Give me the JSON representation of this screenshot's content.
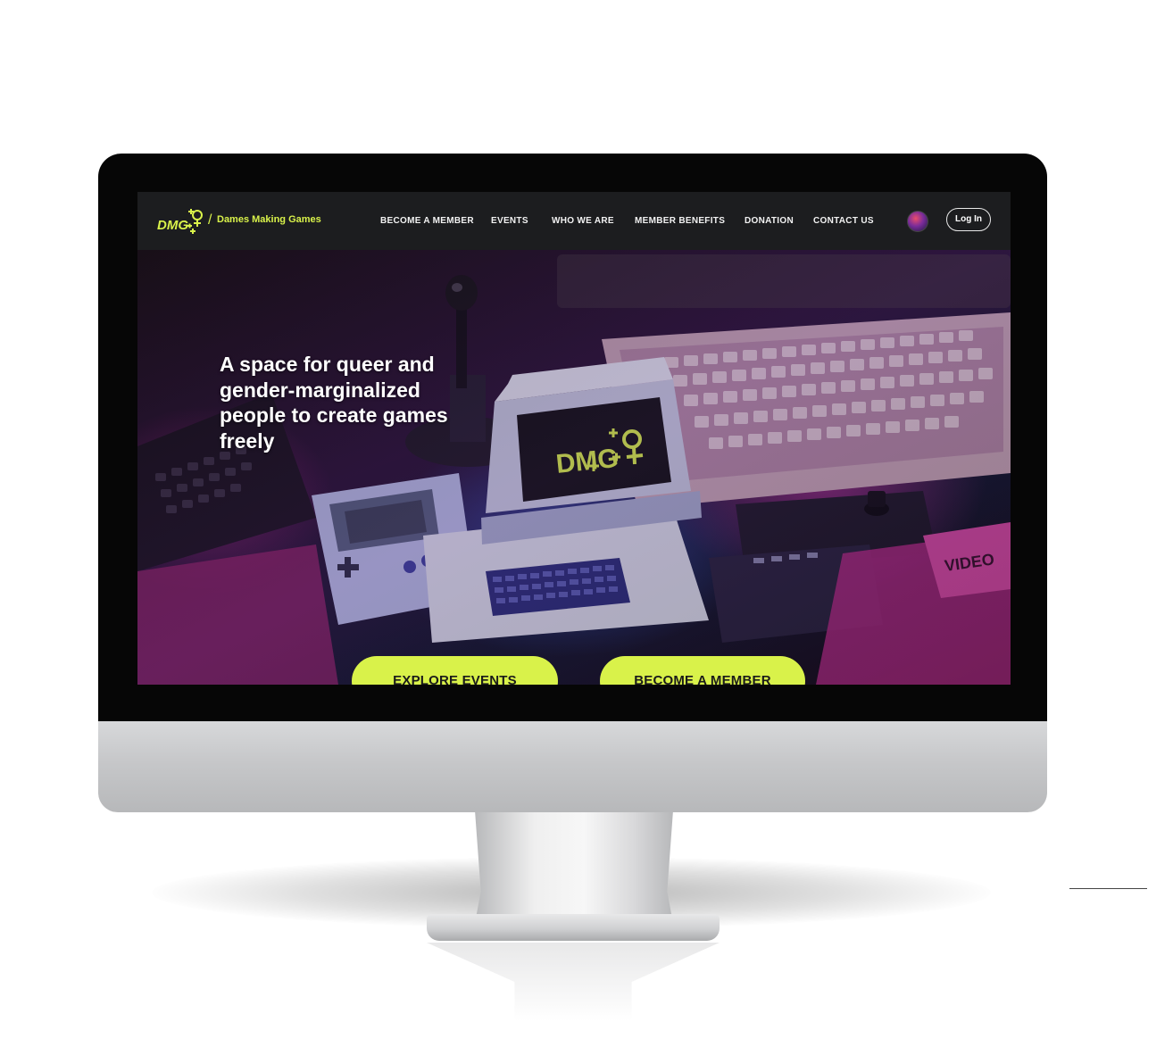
{
  "site": {
    "logo_text": "DMG",
    "logo_slash": "/",
    "name": "Dames Making Games"
  },
  "nav": {
    "items": [
      {
        "label": "BECOME A MEMBER"
      },
      {
        "label": "EVENTS"
      },
      {
        "label": "WHO WE ARE"
      },
      {
        "label": "MEMBER BENEFITS"
      },
      {
        "label": "DONATION"
      },
      {
        "label": "CONTACT US"
      }
    ],
    "login_label": "Log In"
  },
  "hero": {
    "heading": "A space for queer and gender-marginalized people to create games freely",
    "screen_logo": "DMG",
    "primary_cta": "EXPLORE EVENTS",
    "secondary_cta": "BECOME A MEMBER"
  },
  "colors": {
    "accent": "#d9f24a",
    "nav_bg": "#1c1d1f"
  }
}
